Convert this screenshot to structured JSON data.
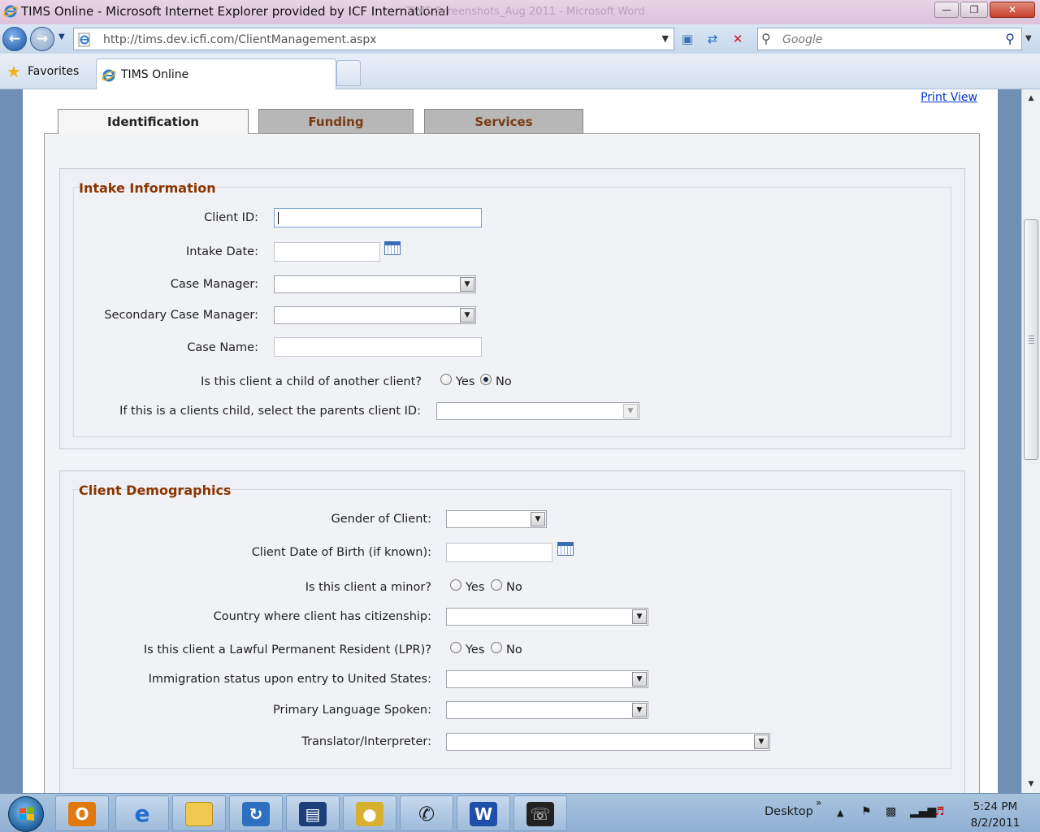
{
  "window": {
    "title": "TIMS Online - Microsoft Internet Explorer provided by ICF International",
    "background_title": "TIMS Screenshots_Aug 2011 - Microsoft Word",
    "controls": {
      "minimize": "—",
      "restore": "❐",
      "close": "✕"
    }
  },
  "address_bar": {
    "url": "http://tims.dev.icfi.com/ClientManagement.aspx",
    "search_placeholder": "Google"
  },
  "favorites_bar": {
    "favorites_label": "Favorites",
    "tab_title": "TIMS Online"
  },
  "page": {
    "print_view": "Print View",
    "tabs": [
      {
        "label": "Identification",
        "active": true
      },
      {
        "label": "Funding",
        "active": false
      },
      {
        "label": "Services",
        "active": false
      }
    ],
    "intake": {
      "title": "Intake Information",
      "client_id_label": "Client ID:",
      "client_id_value": "",
      "intake_date_label": "Intake Date:",
      "intake_date_value": "",
      "case_manager_label": "Case Manager:",
      "case_manager_value": "",
      "secondary_case_manager_label": "Secondary Case Manager:",
      "secondary_case_manager_value": "",
      "case_name_label": "Case Name:",
      "case_name_value": "",
      "child_question": "Is this client a child of another client?",
      "child_answer": "No",
      "parent_question": "If this is a clients child, select the parents client ID:",
      "parent_value": ""
    },
    "demographics": {
      "title": "Client Demographics",
      "gender_label": "Gender of Client:",
      "dob_label": "Client Date of Birth (if known):",
      "minor_question": "Is this client a minor?",
      "country_label": "Country where client has citizenship:",
      "lpr_question": "Is this client a Lawful Permanent Resident (LPR)?",
      "immigration_label": "Immigration status upon entry to United States:",
      "language_label": "Primary Language Spoken:",
      "translator_label": "Translator/Interpreter:"
    },
    "yes_label": "Yes",
    "no_label": "No"
  },
  "taskbar": {
    "apps": [
      "outlook-icon",
      "internet-explorer-icon",
      "folder-icon",
      "sync-icon",
      "network-icon",
      "vpn-lock-icon",
      "phone-icon",
      "word-icon",
      "dialer-icon"
    ],
    "desktop_label": "Desktop",
    "time": "5:24 PM",
    "date": "8/2/2011"
  },
  "colors": {
    "section_title": "#8b3500",
    "inactive_tab": "#b7b7b7",
    "link": "#0033cc"
  }
}
